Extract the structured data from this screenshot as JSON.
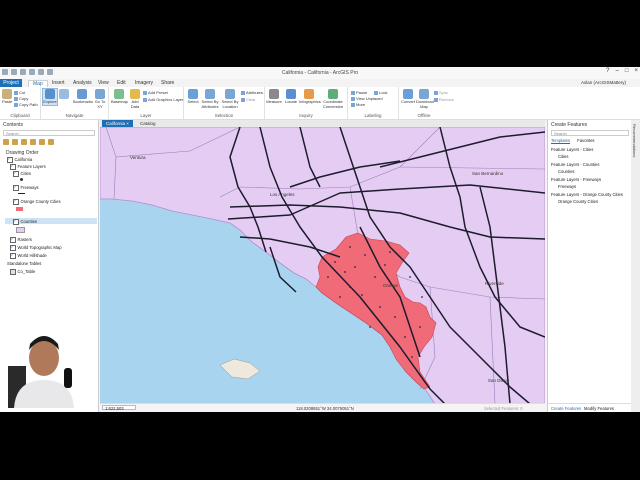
{
  "window": {
    "title": "California - California - ArcGIS Pro",
    "user": "Aslan (ArcGISMattery)"
  },
  "ribbon_tabs": [
    "Project",
    "Map",
    "Insert",
    "Analysis",
    "View",
    "Edit",
    "Imagery",
    "Share"
  ],
  "ribbon": {
    "clipboard": {
      "label": "Clipboard",
      "paste": "Paste",
      "cut": "Cut",
      "copy": "Copy",
      "copy_path": "Copy Path"
    },
    "navigate": {
      "label": "Navigate",
      "explore": "Explore",
      "bookmarks": "Bookmarks",
      "goto": "Go To XY"
    },
    "layer": {
      "label": "Layer",
      "basemap": "Basemap",
      "add_data": "Add Data",
      "add_preset": "Add Preset",
      "add_graphics": "Add Graphics Layer"
    },
    "selection": {
      "label": "Selection",
      "select": "Select",
      "by_attributes": "Select By Attributes",
      "by_location": "Select By Location",
      "attributes": "Attributes",
      "clear": "Clear"
    },
    "inquiry": {
      "label": "Inquiry",
      "measure": "Measure",
      "locate": "Locate",
      "infographics": "Infographics",
      "coord_conv": "Coordinate Conversion"
    },
    "labeling": {
      "label": "Labeling",
      "pause": "Pause",
      "lock": "Lock",
      "view_unplaced": "View Unplaced",
      "more": "More"
    },
    "offline": {
      "label": "Offline",
      "convert": "Convert",
      "download_map": "Download Map",
      "sync": "Sync",
      "remove": "Remove"
    }
  },
  "contents": {
    "title": "Contents",
    "search_placeholder": "Search",
    "drawing_order": "Drawing Order",
    "map_name": "California",
    "items": [
      {
        "label": "Feature Layers"
      },
      {
        "label": "Cities"
      },
      {
        "label": "Freeways"
      },
      {
        "label": "Orange County Cities"
      },
      {
        "label": "Counties"
      },
      {
        "label": "Rasters"
      },
      {
        "label": "World Topographic Map"
      },
      {
        "label": "World Hillshade"
      },
      {
        "label": "Standalone Tables"
      },
      {
        "label": "Co_Table"
      }
    ]
  },
  "map": {
    "tabs": [
      "California",
      "Catalog"
    ],
    "scale": "1:622,503",
    "coords": "118.0208851°W 34.0075051°N",
    "selected_features": "Selected Features: 0",
    "city_labels": [
      "Ventura",
      "Los Angeles",
      "San Bernardino",
      "Riverside",
      "Orange",
      "San Diego"
    ]
  },
  "create_features": {
    "title": "Create Features",
    "search_placeholder": "Search",
    "tabs": [
      "Templates",
      "Favorites"
    ],
    "groups": [
      {
        "header": "Feature Layers - Cities",
        "item": "Cities"
      },
      {
        "header": "Feature Layers - Counties",
        "item": "Counties"
      },
      {
        "header": "Feature Layers - Freeways",
        "item": "Freeways"
      },
      {
        "header": "Feature Layers - Orange County Cities",
        "item": "Orange County Cities"
      }
    ],
    "bottom_tabs": [
      "Create Features",
      "Modify Features"
    ]
  },
  "right_strip": "Recommendations",
  "colors": {
    "accent": "#1f6fb7",
    "land": "#e5ccf3",
    "ocean": "#a8d4ef",
    "orange_county": "#f06a78",
    "freeways": "#1c1c2c"
  }
}
